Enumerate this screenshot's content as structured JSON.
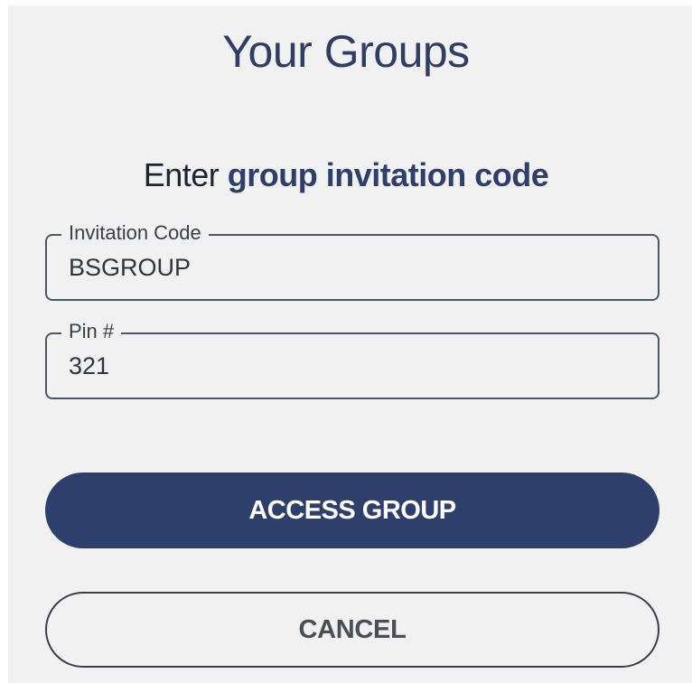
{
  "header": {
    "title": "Your Groups"
  },
  "instructions": {
    "prefix": "Enter ",
    "emphasis": "group invitation code"
  },
  "form": {
    "invitation_code": {
      "label": "Invitation Code",
      "value": "BSGROUP"
    },
    "pin": {
      "label": "Pin #",
      "value": "321"
    }
  },
  "actions": {
    "access_label": "ACCESS GROUP",
    "cancel_label": "CANCEL"
  },
  "colors": {
    "primary": "#2d3f6a",
    "background": "#f1f1f1"
  }
}
